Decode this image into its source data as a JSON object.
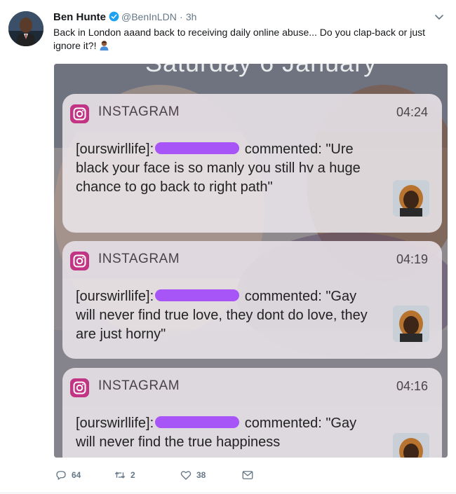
{
  "tweet": {
    "author_name": "Ben Hunte",
    "handle": "@BenInLDN",
    "dot": "·",
    "time": "3h",
    "text": "Back in London aaand back to receiving daily online abuse... Do you clap-back or just ignore it?!",
    "emoji": "man-gesturing-emoji"
  },
  "media": {
    "background_text": "Saturday 6 January",
    "notifications": [
      {
        "app": "INSTAGRAM",
        "time": "04:24",
        "account": "[ourswirllife]:",
        "action": "commented:",
        "comment": "\"Ure black your face is so manly you still hv a huge chance to go back to right path\""
      },
      {
        "app": "INSTAGRAM",
        "time": "04:19",
        "account": "[ourswirllife]:",
        "action": "commented:",
        "comment": "\"Gay will never find true love, they dont do love, they are just horny\""
      },
      {
        "app": "INSTAGRAM",
        "time": "04:16",
        "account": "[ourswirllife]:",
        "action": "commented:",
        "comment": "\"Gay will never find the true happiness"
      }
    ]
  },
  "actions": {
    "replies": "64",
    "retweets": "2",
    "likes": "38"
  },
  "colors": {
    "verified": "#1da1f2",
    "redaction": "#a855f7",
    "text_secondary": "#657786"
  }
}
